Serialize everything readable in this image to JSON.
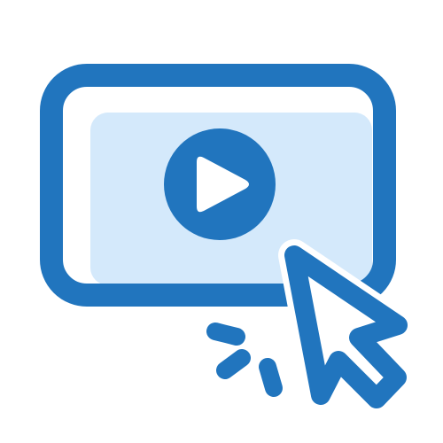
{
  "icon": {
    "name": "video-click-icon",
    "colors": {
      "stroke": "#2175be",
      "fill_light": "#d4e9fb",
      "background": "#ffffff"
    }
  }
}
